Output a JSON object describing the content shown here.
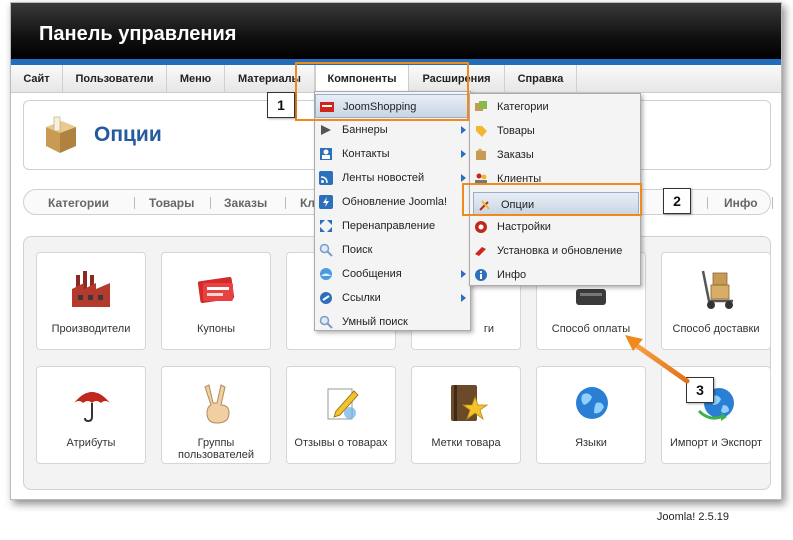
{
  "header": {
    "title": "Панель управления"
  },
  "menubar": {
    "items": [
      "Сайт",
      "Пользователи",
      "Меню",
      "Материалы",
      "Компоненты",
      "Расширения",
      "Справка"
    ]
  },
  "page": {
    "title": "Опции"
  },
  "subtabs": [
    "Категории",
    "Товары",
    "Заказы",
    "Клие",
    "Инфо"
  ],
  "subtab_partial_right": "ле",
  "tiles": [
    {
      "label": "Производители",
      "icon": "factory-icon"
    },
    {
      "label": "Купоны",
      "icon": "coupon-icon"
    },
    {
      "label": "",
      "icon": "hidden-icon"
    },
    {
      "label": "ги",
      "icon": "hidden-icon"
    },
    {
      "label": "Способ оплаты",
      "icon": "payment-icon"
    },
    {
      "label": "Способ доставки",
      "icon": "delivery-cart-icon"
    },
    {
      "label": "Атрибуты",
      "icon": "umbrella-icon"
    },
    {
      "label": "Группы пользователей",
      "icon": "peace-hand-icon"
    },
    {
      "label": "Отзывы о товарах",
      "icon": "review-pen-icon"
    },
    {
      "label": "Метки товара",
      "icon": "book-star-icon"
    },
    {
      "label": "Языки",
      "icon": "globe-icon"
    },
    {
      "label": "Импорт и Экспорт",
      "icon": "import-export-icon"
    }
  ],
  "components_menu": [
    {
      "label": "JoomShopping",
      "submenu": false,
      "highlight": true
    },
    {
      "label": "Баннеры",
      "submenu": true
    },
    {
      "label": "Контакты",
      "submenu": true
    },
    {
      "label": "Ленты новостей",
      "submenu": true
    },
    {
      "label": "Обновление Joomla!",
      "submenu": false
    },
    {
      "label": "Перенаправление",
      "submenu": false
    },
    {
      "label": "Поиск",
      "submenu": false
    },
    {
      "label": "Сообщения",
      "submenu": true
    },
    {
      "label": "Ссылки",
      "submenu": true
    },
    {
      "label": "Умный поиск",
      "submenu": false
    }
  ],
  "joomshopping_menu": [
    {
      "label": "Категории"
    },
    {
      "label": "Товары"
    },
    {
      "label": "Заказы"
    },
    {
      "label": "Клиенты"
    },
    {
      "label": "Опции",
      "highlight": true
    },
    {
      "label": "Настройки"
    },
    {
      "label": "Установка и обновление"
    },
    {
      "label": "Инфо"
    }
  ],
  "callouts": [
    "1",
    "2",
    "3"
  ],
  "footer": {
    "version": "Joomla! 2.5.19"
  },
  "colors": {
    "accent_blue": "#1f6dbb",
    "annotation_orange": "#f08a1e",
    "title_blue": "#245b9d"
  }
}
